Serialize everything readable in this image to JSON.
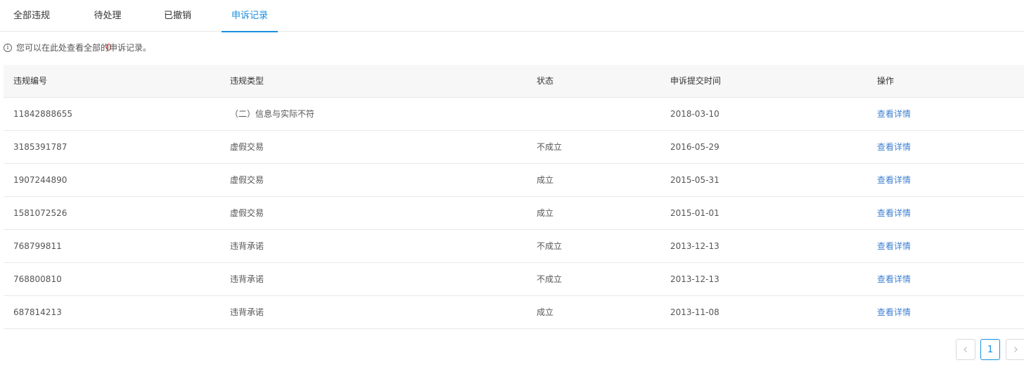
{
  "tabs": [
    {
      "label": "全部违规"
    },
    {
      "label": "待处理",
      "count": "0"
    },
    {
      "label": "已撤销"
    },
    {
      "label": "申诉记录"
    }
  ],
  "notice": {
    "icon": "info-icon",
    "text": "您可以在此处查看全部的申诉记录。"
  },
  "table": {
    "headers": [
      "违规编号",
      "违规类型",
      "状态",
      "申诉提交时间",
      "操作"
    ],
    "rows": [
      {
        "id": "11842888655",
        "type": "（二）信息与实际不符",
        "status": "",
        "date": "2018-03-10",
        "action": "查看详情"
      },
      {
        "id": "3185391787",
        "type": "虚假交易",
        "status": "不成立",
        "date": "2016-05-29",
        "action": "查看详情"
      },
      {
        "id": "1907244890",
        "type": "虚假交易",
        "status": "成立",
        "date": "2015-05-31",
        "action": "查看详情"
      },
      {
        "id": "1581072526",
        "type": "虚假交易",
        "status": "成立",
        "date": "2015-01-01",
        "action": "查看详情"
      },
      {
        "id": "768799811",
        "type": "违背承诺",
        "status": "不成立",
        "date": "2013-12-13",
        "action": "查看详情"
      },
      {
        "id": "768800810",
        "type": "违背承诺",
        "status": "不成立",
        "date": "2013-12-13",
        "action": "查看详情"
      },
      {
        "id": "687814213",
        "type": "违背承诺",
        "status": "成立",
        "date": "2013-11-08",
        "action": "查看详情"
      }
    ]
  },
  "pagination": {
    "current": "1",
    "prev_icon": "chevron-left-icon",
    "next_icon": "chevron-right-icon"
  },
  "colors": {
    "accent": "#1a8fe0",
    "count": "#e4393c",
    "link": "#3f7fd0"
  }
}
